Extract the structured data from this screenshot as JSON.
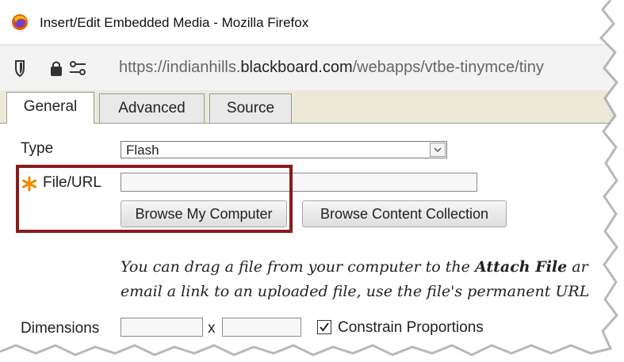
{
  "window": {
    "title": "Insert/Edit Embedded Media - Mozilla Firefox",
    "url_prefix": "https://indianhills.",
    "url_domain": "blackboard.com",
    "url_suffix": "/webapps/vtbe-tinymce/tiny"
  },
  "tabs": [
    {
      "label": "General",
      "active": true
    },
    {
      "label": "Advanced",
      "active": false
    },
    {
      "label": "Source",
      "active": false
    }
  ],
  "form": {
    "type_label": "Type",
    "type_value": "Flash",
    "file_label": "File/URL",
    "file_value": "",
    "browse_computer": "Browse My Computer",
    "browse_collection": "Browse Content Collection",
    "info_line1_pre": "You can drag a file from your computer to the ",
    "info_line1_bold": "Attach File",
    "info_line1_post": " ar",
    "info_line2": "email a link to an uploaded file, use the file's permanent URL",
    "dimensions_label": "Dimensions",
    "dim_x": "x",
    "constrain_label": "Constrain Proportions",
    "constrain_checked": true
  },
  "colors": {
    "highlight": "#8b1a1a",
    "required_star": "#f08a00",
    "tab_strip": "#ece9d8"
  }
}
